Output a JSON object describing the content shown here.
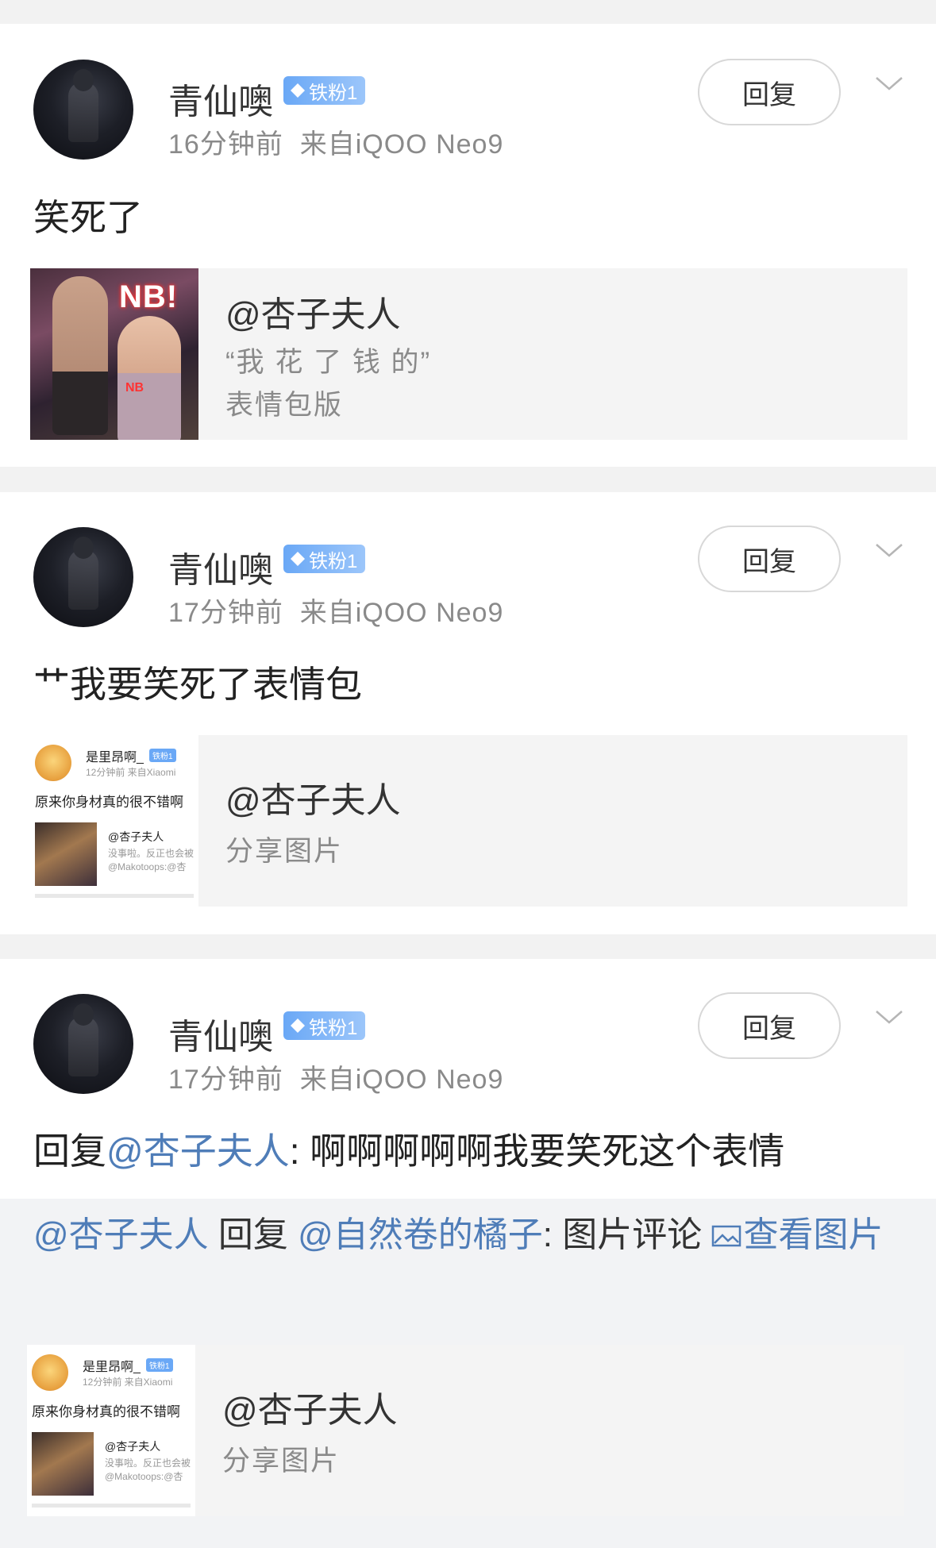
{
  "comments": [
    {
      "username": "青仙噢",
      "badge": "铁粉1",
      "time": "16分钟前",
      "source": "来自iQOO Neo9",
      "reply_label": "回复",
      "text": "笑死了",
      "share": {
        "title": "@杏子夫人",
        "line1": "“我 花 了 钱 的”",
        "line2": "表情包版",
        "thumb_overlay": "NB!",
        "thumb_overlay_small": "NB"
      }
    },
    {
      "username": "青仙噢",
      "badge": "铁粉1",
      "time": "17分钟前",
      "source": "来自iQOO Neo9",
      "reply_label": "回复",
      "text": "艹我要笑死了表情包",
      "share": {
        "title": "@杏子夫人",
        "line1": "分享图片",
        "mini": {
          "name": "是里昂啊_",
          "badge": "铁粉1",
          "meta": "12分钟前  来自Xiaomi",
          "text": "原来你身材真的很不错啊",
          "at": "@杏子夫人",
          "s1": "没事啦。反正也会被",
          "s2": "@Makotoops:@杏"
        }
      }
    },
    {
      "username": "青仙噢",
      "badge": "铁粉1",
      "time": "17分钟前",
      "source": "来自iQOO Neo9",
      "reply_label": "回复",
      "text_prefix": "回复",
      "text_mention": "@杏子夫人",
      "text_body": ": 啊啊啊啊啊我要笑死这个表情",
      "quote": {
        "mention1": "@杏子夫人",
        "mid": " 回复 ",
        "mention2": "@自然卷的橘子",
        "body": ": 图片评论 ",
        "view_label": "查看图片"
      },
      "share": {
        "title": "@杏子夫人",
        "line1": "分享图片",
        "mini": {
          "name": "是里昂啊_",
          "badge": "铁粉1",
          "meta": "12分钟前  来自Xiaomi",
          "text": "原来你身材真的很不错啊",
          "at": "@杏子夫人",
          "s1": "没事啦。反正也会被",
          "s2": "@Makotoops:@杏"
        }
      }
    }
  ],
  "colors": {
    "link": "#4f7db8",
    "badge": "#6aa8f6",
    "background": "#f2f2f2"
  }
}
